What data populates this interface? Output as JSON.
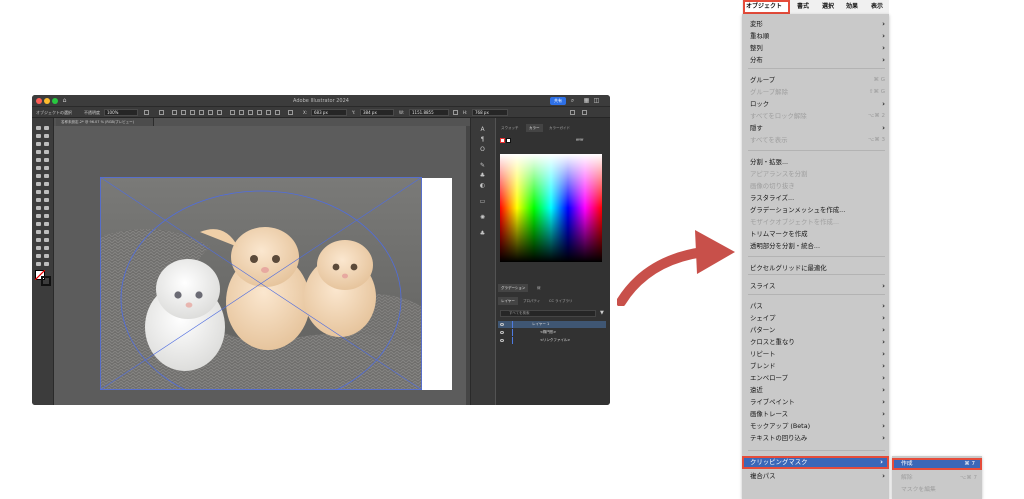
{
  "illustrator": {
    "app_title": "Adobe Illustrator 2024",
    "share_label": "共有",
    "control_bar": {
      "selection_label": "オブジェクトの選択",
      "opacity_label": "不透明度",
      "opacity_value": "100%",
      "x_label": "X:",
      "x_value": "683 px",
      "y_label": "Y:",
      "y_value": "384 px",
      "w_label": "W:",
      "w_value": "1151.8855",
      "h_label": "H:",
      "h_value": "768 px"
    },
    "doc_tab": "名称未設定-2* @ 96.07 % (RGB/プレビュー)",
    "panel": {
      "tabs": [
        "スウォッチ",
        "カラー",
        "カラーガイド"
      ],
      "hex_value": "ffffff",
      "subtabs": [
        "グラデーション",
        "線"
      ],
      "layer_tabs": [
        "レイヤー",
        "プロパティ",
        "CC ライブラリ"
      ],
      "search_placeholder": "すべてを検索",
      "layers": [
        "レイヤー 1",
        "<楕円形>",
        "<リンクファイル>"
      ]
    }
  },
  "menubar": {
    "items": [
      "オブジェクト",
      "書式",
      "選択",
      "効果",
      "表示"
    ]
  },
  "menu": {
    "items": [
      {
        "label": "変形",
        "sub": true
      },
      {
        "label": "重ね順",
        "sub": true
      },
      {
        "label": "整列",
        "sub": true
      },
      {
        "label": "分布",
        "sub": true
      },
      {
        "label": "グループ",
        "shortcut": "⌘ G"
      },
      {
        "label": "グループ解除",
        "shortcut": "⇧⌘ G",
        "disabled": true
      },
      {
        "label": "ロック",
        "sub": true
      },
      {
        "label": "すべてをロック解除",
        "shortcut": "⌥⌘ 2",
        "disabled": true
      },
      {
        "label": "隠す",
        "sub": true
      },
      {
        "label": "すべてを表示",
        "shortcut": "⌥⌘ 3",
        "disabled": true
      },
      {
        "label": "分割・拡張..."
      },
      {
        "label": "アピアランスを分割",
        "disabled": true
      },
      {
        "label": "画像の切り抜き",
        "disabled": true
      },
      {
        "label": "ラスタライズ..."
      },
      {
        "label": "グラデーションメッシュを作成..."
      },
      {
        "label": "モザイクオブジェクトを作成...",
        "disabled": true
      },
      {
        "label": "トリムマークを作成"
      },
      {
        "label": "透明部分を分割・統合..."
      },
      {
        "label": "ピクセルグリッドに最適化"
      },
      {
        "label": "スライス",
        "sub": true
      },
      {
        "label": "パス",
        "sub": true
      },
      {
        "label": "シェイプ",
        "sub": true
      },
      {
        "label": "パターン",
        "sub": true
      },
      {
        "label": "クロスと重なり",
        "sub": true
      },
      {
        "label": "リピート",
        "sub": true
      },
      {
        "label": "ブレンド",
        "sub": true
      },
      {
        "label": "エンベロープ",
        "sub": true
      },
      {
        "label": "遠近",
        "sub": true
      },
      {
        "label": "ライブペイント",
        "sub": true
      },
      {
        "label": "画像トレース",
        "sub": true
      },
      {
        "label": "モックアップ (Beta)",
        "sub": true
      },
      {
        "label": "テキストの回り込み",
        "sub": true
      },
      {
        "label": "クリッピングマスク",
        "sub": true,
        "highlighted": true
      },
      {
        "label": "複合パス",
        "sub": true
      }
    ]
  },
  "submenu": {
    "items": [
      {
        "label": "作成",
        "shortcut": "⌘ 7",
        "highlighted": true
      },
      {
        "label": "解除",
        "shortcut": "⌥⌘ 7",
        "disabled": true
      },
      {
        "label": "マスクを編集",
        "disabled": true
      }
    ]
  },
  "colors": {
    "accent_red": "#e54c3a",
    "menu_highlight": "#3a67b8",
    "arrow": "#c8504a"
  }
}
